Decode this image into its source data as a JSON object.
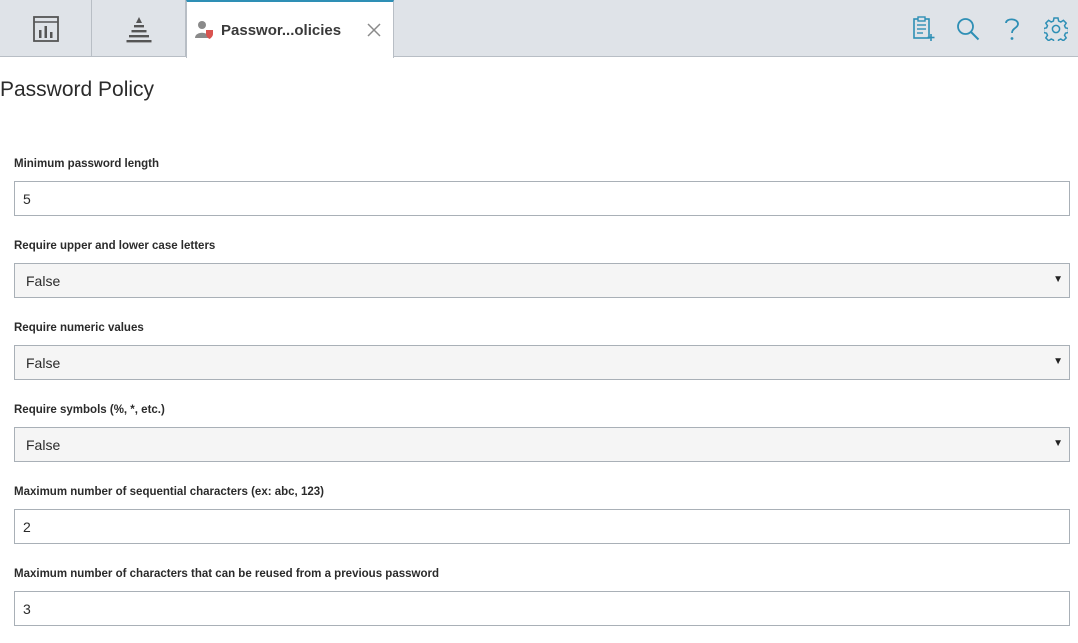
{
  "tabs": {
    "active_label": "Passwor...olicies"
  },
  "page": {
    "title": "Password Policy"
  },
  "fields": [
    {
      "label": "Minimum password length",
      "value": "5"
    },
    {
      "label": "Require upper and lower case letters",
      "value": "False"
    },
    {
      "label": "Require numeric values",
      "value": "False"
    },
    {
      "label": "Require symbols (%, *, etc.)",
      "value": "False"
    },
    {
      "label": "Maximum number of sequential characters (ex: abc, 123)",
      "value": "2"
    },
    {
      "label": "Maximum number of characters that can be reused from a previous password",
      "value": "3"
    }
  ],
  "icons": {
    "tab1": "dashboard-icon",
    "tab2": "hierarchy-icon",
    "active_tab": "user-policy-icon",
    "actions": [
      "new-report-icon",
      "search-icon",
      "help-icon",
      "settings-icon"
    ]
  },
  "colors": {
    "accent": "#2e8fb5",
    "topbar": "#dfe3e8"
  }
}
